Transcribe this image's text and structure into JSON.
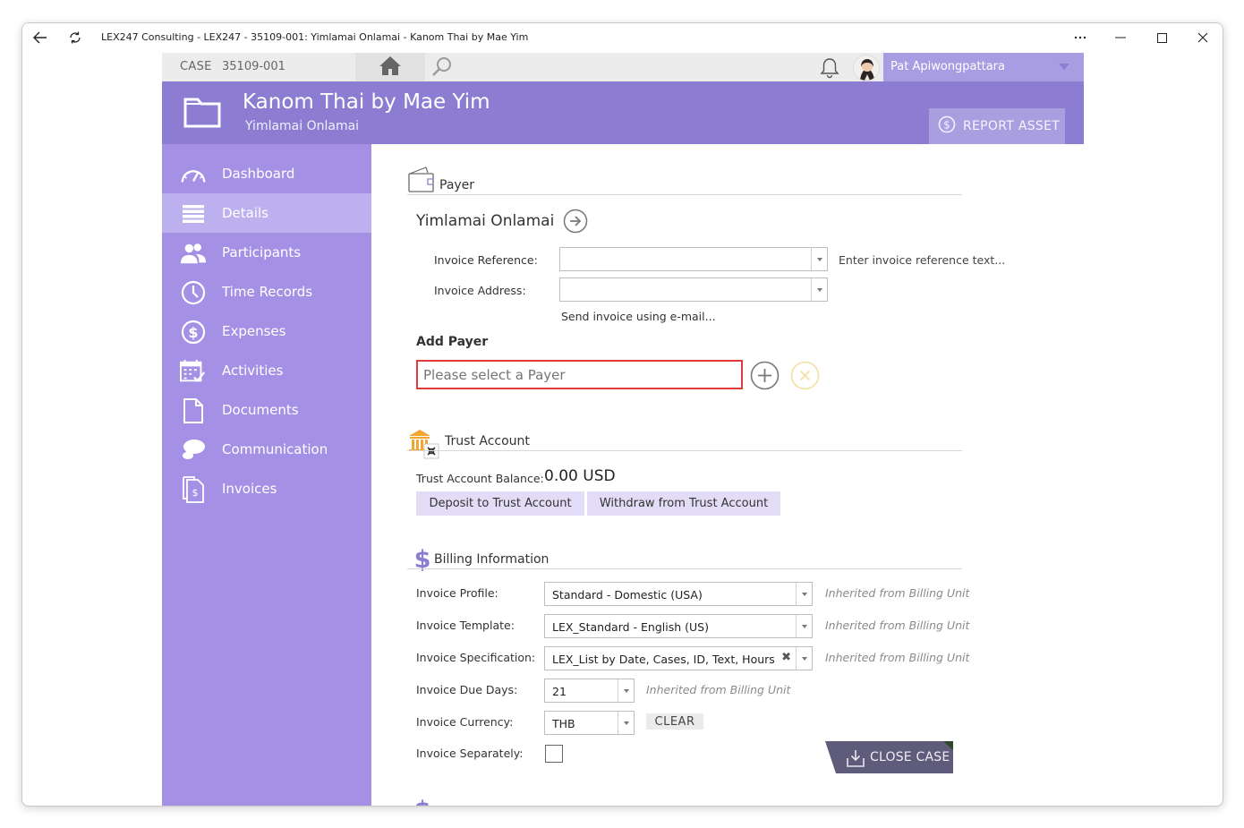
{
  "window": {
    "title": "LEX247 Consulting - LEX247 - 35109-001: Yimlamai Onlamai - Kanom Thai by Mae Yim"
  },
  "topbar": {
    "case_label": "CASE",
    "case_number": "35109-001",
    "user_name": "Pat Apiwongpattara"
  },
  "header": {
    "title": "Kanom Thai by Mae Yim",
    "subtitle": "Yimlamai Onlamai",
    "report_asset_label": "REPORT ASSET"
  },
  "sidebar": {
    "items": [
      {
        "label": "Dashboard",
        "icon": "dashboard-gauge-icon"
      },
      {
        "label": "Details",
        "icon": "details-list-icon"
      },
      {
        "label": "Participants",
        "icon": "participants-icon"
      },
      {
        "label": "Time Records",
        "icon": "clock-icon"
      },
      {
        "label": "Expenses",
        "icon": "dollar-icon"
      },
      {
        "label": "Activities",
        "icon": "calendar-icon"
      },
      {
        "label": "Documents",
        "icon": "document-icon"
      },
      {
        "label": "Communication",
        "icon": "chat-icon"
      },
      {
        "label": "Invoices",
        "icon": "invoice-icon"
      }
    ],
    "active_index": 1
  },
  "payer": {
    "section_title": "Payer",
    "payer_name": "Yimlamai Onlamai",
    "invoice_reference_label": "Invoice Reference:",
    "invoice_reference_value": "",
    "invoice_reference_hint": "Enter invoice reference text...",
    "invoice_address_label": "Invoice Address:",
    "invoice_address_value": "",
    "send_email_link": "Send invoice using e-mail...",
    "add_payer_label": "Add Payer",
    "add_payer_placeholder": "Please select a Payer"
  },
  "trust": {
    "section_title": "Trust Account",
    "balance_label": "Trust Account Balance:",
    "balance_value": "0.00 USD",
    "deposit_label": "Deposit to Trust Account",
    "withdraw_label": "Withdraw from Trust Account"
  },
  "billing": {
    "section_title": "Billing Information",
    "profile_label": "Invoice Profile:",
    "profile_value": "Standard - Domestic (USA)",
    "template_label": "Invoice Template:",
    "template_value": "LEX_Standard - English (US)",
    "spec_label": "Invoice Specification:",
    "spec_value": "LEX_List by Date, Cases, ID, Text, Hours, ...",
    "due_days_label": "Invoice Due Days:",
    "due_days_value": "21",
    "currency_label": "Invoice Currency:",
    "currency_value": "THB",
    "clear_label": "CLEAR",
    "separately_label": "Invoice Separately:",
    "inherited_text": "Inherited from Billing Unit"
  },
  "footer": {
    "close_case_label": "CLOSE CASE"
  },
  "colors": {
    "header_purple": "#8d7dd2",
    "sidebar_purple": "#a491e6",
    "active_item": "#bdb0ef",
    "error_red": "#e03a3a",
    "close_case_bg": "#5f5b7a"
  }
}
